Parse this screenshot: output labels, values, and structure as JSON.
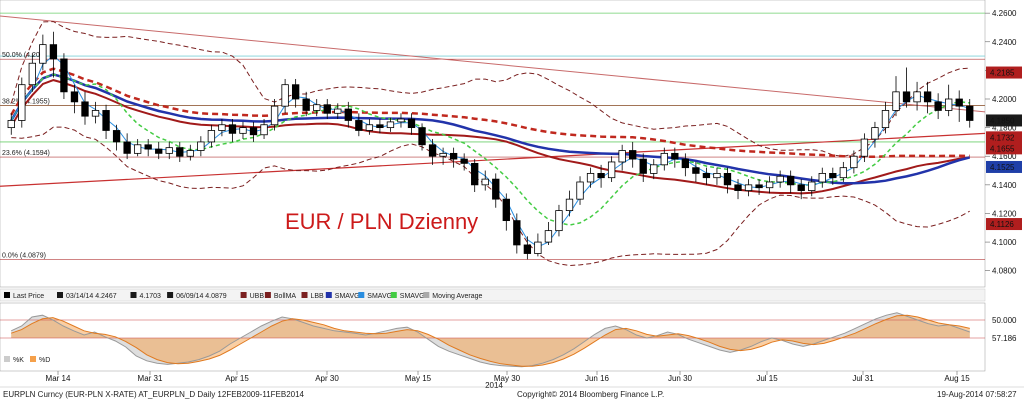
{
  "chart_data": [
    {
      "type": "candlestick",
      "title": "EUR / PLN Dzienny",
      "ylim": [
        4.07,
        4.265
      ],
      "yticks": [
        "4.2600",
        "4.2400",
        "4.2200",
        "4.2000",
        "4.1800",
        "4.1600",
        "4.1400",
        "4.1200",
        "4.1000",
        "4.0800"
      ],
      "xticks": [
        "Mar 14",
        "Mar 31",
        "Apr 15",
        "Apr 30",
        "May 15",
        "May 30",
        "Jun 16",
        "Jun 30",
        "Jul 15",
        "Jul 31",
        "Aug 15"
      ],
      "year_label": "2014",
      "right_labels": [
        {
          "text": "4.2185",
          "color": "#b01e1e",
          "value": 4.2185
        },
        {
          "text": "4.1850",
          "color": "#1a1a1a",
          "value": 4.185
        },
        {
          "text": "4.1732",
          "color": "#b01e1e",
          "value": 4.1732
        },
        {
          "text": "4.1655",
          "color": "#b01e1e",
          "value": 4.1655
        },
        {
          "text": "4.1525",
          "color": "#1f3fa8",
          "value": 4.1525
        },
        {
          "text": "4.1126",
          "color": "#b01e1e",
          "value": 4.1126
        }
      ],
      "fib_labels": [
        {
          "text": "50.0% (4.20",
          "value": 4.2278
        },
        {
          "text": "38.2% (4.1955)",
          "value": 4.1955
        },
        {
          "text": "23.6% (4.1594)",
          "value": 4.1594
        },
        {
          "text": "0.0% (4.0879)",
          "value": 4.0879
        }
      ],
      "legend": [
        {
          "text": "Last Price",
          "color": "#000000"
        },
        {
          "text": "03/14/14 4.2467",
          "color": "#1a1a1a"
        },
        {
          "text": "4.1703",
          "color": "#1a1a1a"
        },
        {
          "text": "06/09/14 4.0879",
          "color": "#1a1a1a"
        },
        {
          "text": "UBB",
          "color": "#7a1f1f"
        },
        {
          "text": "BollMA",
          "color": "#7a1f1f"
        },
        {
          "text": "LBB",
          "color": "#7a1f1f"
        },
        {
          "text": "SMAVG",
          "color": "#2233aa"
        },
        {
          "text": "SMAVG",
          "color": "#2a8ee0"
        },
        {
          "text": "SMAVG",
          "color": "#44cc44"
        },
        {
          "text": "Moving Average",
          "color": "#aaaaaa"
        }
      ],
      "candles": [
        [
          4.18,
          4.185,
          4.175,
          4.19
        ],
        [
          4.185,
          4.21,
          4.18,
          4.215
        ],
        [
          4.21,
          4.225,
          4.205,
          4.232
        ],
        [
          4.225,
          4.238,
          4.22,
          4.245
        ],
        [
          4.238,
          4.228,
          4.215,
          4.247
        ],
        [
          4.228,
          4.205,
          4.2,
          4.232
        ],
        [
          4.205,
          4.198,
          4.19,
          4.21
        ],
        [
          4.198,
          4.188,
          4.182,
          4.205
        ],
        [
          4.188,
          4.192,
          4.183,
          4.198
        ],
        [
          4.192,
          4.178,
          4.172,
          4.196
        ],
        [
          4.178,
          4.17,
          4.164,
          4.182
        ],
        [
          4.17,
          4.162,
          4.158,
          4.176
        ],
        [
          4.162,
          4.168,
          4.16,
          4.172
        ],
        [
          4.168,
          4.165,
          4.16,
          4.172
        ],
        [
          4.165,
          4.162,
          4.158,
          4.17
        ],
        [
          4.162,
          4.166,
          4.158,
          4.17
        ],
        [
          4.166,
          4.16,
          4.156,
          4.17
        ],
        [
          4.16,
          4.164,
          4.157,
          4.168
        ],
        [
          4.164,
          4.17,
          4.16,
          4.174
        ],
        [
          4.17,
          4.178,
          4.166,
          4.182
        ],
        [
          4.178,
          4.182,
          4.174,
          4.186
        ],
        [
          4.182,
          4.176,
          4.17,
          4.186
        ],
        [
          4.176,
          4.18,
          4.172,
          4.184
        ],
        [
          4.18,
          4.175,
          4.17,
          4.184
        ],
        [
          4.175,
          4.182,
          4.172,
          4.186
        ],
        [
          4.182,
          4.195,
          4.178,
          4.2
        ],
        [
          4.195,
          4.21,
          4.19,
          4.214
        ],
        [
          4.21,
          4.2,
          4.194,
          4.214
        ],
        [
          4.2,
          4.192,
          4.188,
          4.205
        ],
        [
          4.192,
          4.196,
          4.188,
          4.2
        ],
        [
          4.196,
          4.19,
          4.186,
          4.2
        ],
        [
          4.19,
          4.193,
          4.186,
          4.197
        ],
        [
          4.193,
          4.185,
          4.18,
          4.198
        ],
        [
          4.185,
          4.178,
          4.174,
          4.19
        ],
        [
          4.178,
          4.182,
          4.175,
          4.186
        ],
        [
          4.182,
          4.18,
          4.176,
          4.186
        ],
        [
          4.18,
          4.184,
          4.177,
          4.187
        ],
        [
          4.184,
          4.186,
          4.18,
          4.19
        ],
        [
          4.186,
          4.18,
          4.175,
          4.19
        ],
        [
          4.18,
          4.168,
          4.164,
          4.183
        ],
        [
          4.168,
          4.16,
          4.154,
          4.172
        ],
        [
          4.16,
          4.162,
          4.154,
          4.166
        ],
        [
          4.162,
          4.158,
          4.152,
          4.166
        ],
        [
          4.158,
          4.155,
          4.15,
          4.162
        ],
        [
          4.155,
          4.14,
          4.135,
          4.158
        ],
        [
          4.14,
          4.144,
          4.136,
          4.15
        ],
        [
          4.144,
          4.13,
          4.124,
          4.148
        ],
        [
          4.13,
          4.115,
          4.108,
          4.134
        ],
        [
          4.115,
          4.098,
          4.092,
          4.12
        ],
        [
          4.098,
          4.092,
          4.0879,
          4.104
        ],
        [
          4.092,
          4.1,
          4.09,
          4.106
        ],
        [
          4.1,
          4.108,
          4.098,
          4.114
        ],
        [
          4.108,
          4.122,
          4.104,
          4.126
        ],
        [
          4.122,
          4.13,
          4.118,
          4.136
        ],
        [
          4.13,
          4.142,
          4.126,
          4.146
        ],
        [
          4.142,
          4.148,
          4.138,
          4.152
        ],
        [
          4.148,
          4.145,
          4.138,
          4.154
        ],
        [
          4.145,
          4.156,
          4.142,
          4.16
        ],
        [
          4.156,
          4.164,
          4.15,
          4.168
        ],
        [
          4.164,
          4.158,
          4.152,
          4.17
        ],
        [
          4.158,
          4.148,
          4.142,
          4.162
        ],
        [
          4.148,
          4.154,
          4.144,
          4.158
        ],
        [
          4.154,
          4.162,
          4.15,
          4.166
        ],
        [
          4.162,
          4.158,
          4.152,
          4.166
        ],
        [
          4.158,
          4.152,
          4.146,
          4.162
        ],
        [
          4.152,
          4.148,
          4.142,
          4.156
        ],
        [
          4.148,
          4.145,
          4.14,
          4.152
        ],
        [
          4.145,
          4.148,
          4.14,
          4.152
        ],
        [
          4.148,
          4.14,
          4.134,
          4.152
        ],
        [
          4.14,
          4.136,
          4.13,
          4.144
        ],
        [
          4.136,
          4.14,
          4.132,
          4.144
        ],
        [
          4.14,
          4.138,
          4.133,
          4.144
        ],
        [
          4.138,
          4.142,
          4.134,
          4.146
        ],
        [
          4.142,
          4.146,
          4.138,
          4.15
        ],
        [
          4.146,
          4.14,
          4.134,
          4.15
        ],
        [
          4.14,
          4.136,
          4.13,
          4.144
        ],
        [
          4.136,
          4.142,
          4.132,
          4.146
        ],
        [
          4.142,
          4.148,
          4.138,
          4.152
        ],
        [
          4.148,
          4.145,
          4.14,
          4.152
        ],
        [
          4.145,
          4.152,
          4.142,
          4.156
        ],
        [
          4.152,
          4.16,
          4.148,
          4.164
        ],
        [
          4.16,
          4.172,
          4.156,
          4.176
        ],
        [
          4.172,
          4.18,
          4.166,
          4.184
        ],
        [
          4.18,
          4.192,
          4.176,
          4.198
        ],
        [
          4.192,
          4.205,
          4.188,
          4.216
        ],
        [
          4.205,
          4.198,
          4.194,
          4.222
        ],
        [
          4.198,
          4.205,
          4.192,
          4.212
        ],
        [
          4.205,
          4.198,
          4.19,
          4.212
        ],
        [
          4.198,
          4.192,
          4.186,
          4.204
        ],
        [
          4.192,
          4.2,
          4.188,
          4.21
        ],
        [
          4.2,
          4.195,
          4.184,
          4.206
        ],
        [
          4.195,
          4.185,
          4.18,
          4.2
        ]
      ]
    },
    {
      "type": "line",
      "name": "Stochastic",
      "ylim": [
        0,
        100
      ],
      "yticks_right": [
        "50.000",
        "57.186"
      ],
      "legend": [
        {
          "text": "%K",
          "color": "#cccccc"
        },
        {
          "text": "%D",
          "color": "#f5a04a"
        }
      ],
      "k": [
        62,
        70,
        85,
        88,
        80,
        70,
        62,
        55,
        60,
        52,
        45,
        35,
        20,
        12,
        8,
        6,
        8,
        10,
        14,
        20,
        28,
        40,
        50,
        60,
        70,
        78,
        85,
        82,
        76,
        70,
        66,
        62,
        60,
        58,
        55,
        58,
        62,
        66,
        68,
        60,
        48,
        36,
        28,
        22,
        16,
        10,
        6,
        4,
        3,
        2,
        4,
        8,
        14,
        22,
        32,
        44,
        56,
        66,
        70,
        64,
        55,
        50,
        54,
        60,
        56,
        48,
        42,
        36,
        30,
        26,
        30,
        36,
        44,
        50,
        46,
        40,
        36,
        40,
        46,
        52,
        58,
        66,
        74,
        82,
        88,
        92,
        86,
        80,
        74,
        70,
        72,
        66,
        60
      ],
      "d": [
        58,
        64,
        74,
        82,
        84,
        78,
        70,
        62,
        58,
        56,
        52,
        44,
        34,
        22,
        14,
        9,
        7,
        8,
        11,
        15,
        21,
        30,
        40,
        50,
        60,
        70,
        78,
        82,
        80,
        76,
        72,
        66,
        62,
        60,
        58,
        57,
        58,
        61,
        64,
        62,
        56,
        48,
        38,
        30,
        22,
        16,
        11,
        7,
        5,
        3,
        3,
        5,
        9,
        15,
        23,
        33,
        44,
        55,
        64,
        66,
        62,
        56,
        53,
        55,
        57,
        54,
        49,
        43,
        36,
        31,
        29,
        31,
        36,
        43,
        47,
        45,
        41,
        39,
        41,
        46,
        52,
        58,
        66,
        74,
        81,
        87,
        88,
        85,
        80,
        75,
        72,
        70,
        66
      ]
    }
  ],
  "status_bar": {
    "left": "EURPLN Curncy (EUR-PLN X-RATE) AT_EURPLN_D  Daily 12FEB2009-11FEB2014",
    "center": "Copyright© 2014 Bloomberg Finance L.P.",
    "right": "19-Aug-2014 07:58:27"
  },
  "colors": {
    "up": "#ffffff",
    "down": "#000000",
    "boll": "#7a1f1f",
    "bollma": "#c0281e",
    "sma_blue": "#2233aa",
    "sma_green": "#44cc44",
    "ma_red": "#a11a1a"
  }
}
